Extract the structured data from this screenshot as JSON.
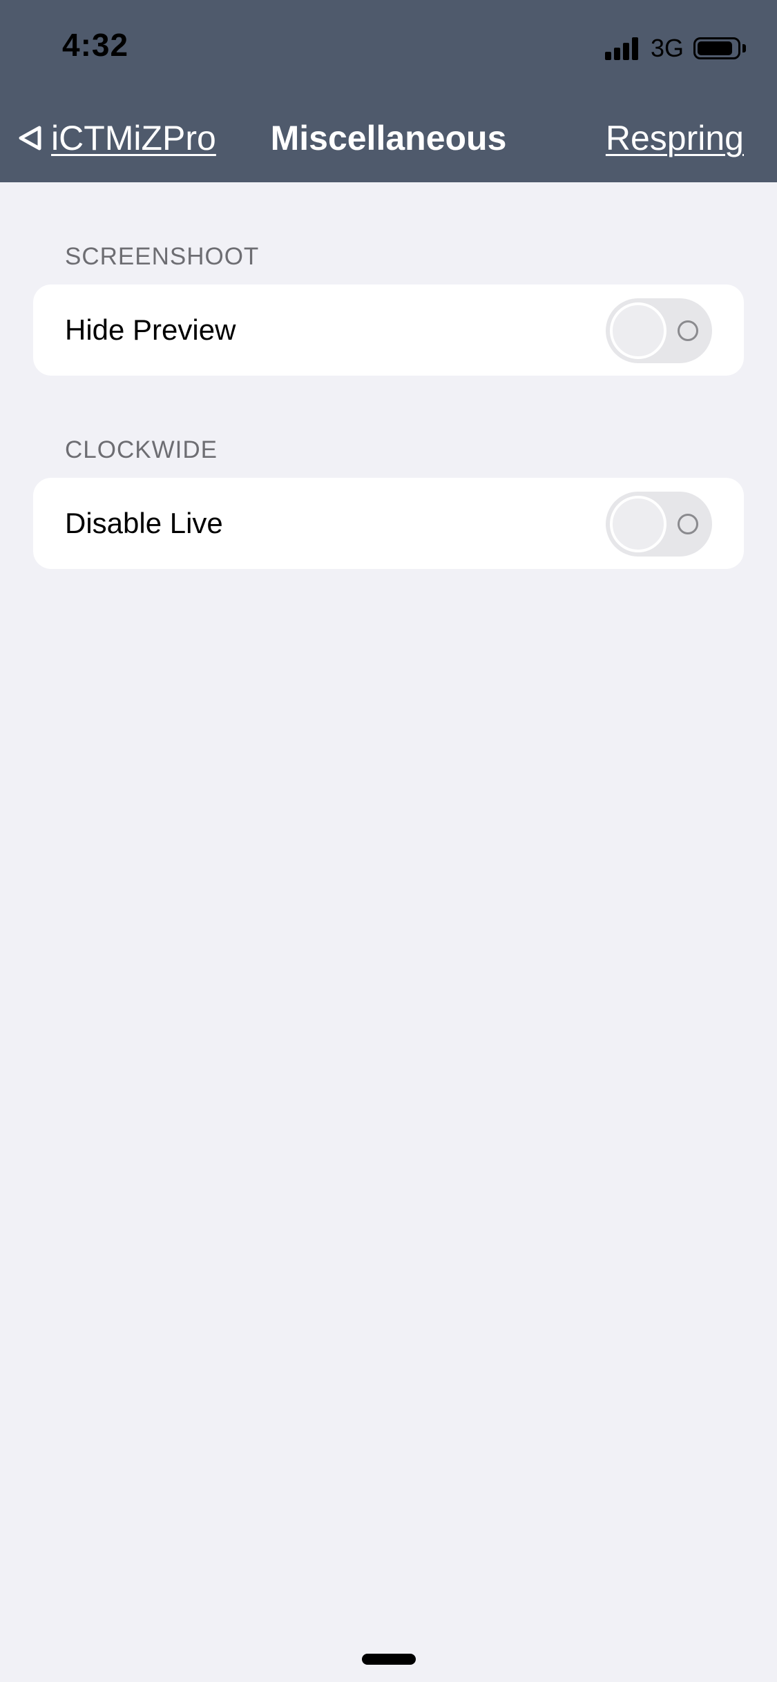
{
  "status_bar": {
    "time": "4:32",
    "network": "3G",
    "signal_bars": 4,
    "battery_level": 0.9,
    "signal_icon": "cellular-signal-icon",
    "battery_icon": "battery-icon"
  },
  "nav": {
    "back_label": "iCTMiZPro",
    "back_icon": "back-triangle-icon",
    "title": "Miscellaneous",
    "action_label": "Respring",
    "background_color": "#4f5a6c"
  },
  "sections": [
    {
      "header": "SCREENSHOOT",
      "cells": [
        {
          "label": "Hide Preview",
          "toggle_on": false
        }
      ]
    },
    {
      "header": "CLOCKWIDE",
      "cells": [
        {
          "label": "Disable Live",
          "toggle_on": false
        }
      ]
    }
  ],
  "colors": {
    "page_background": "#f1f1f6",
    "card_background": "#ffffff",
    "section_header_text": "#6d6d72"
  }
}
